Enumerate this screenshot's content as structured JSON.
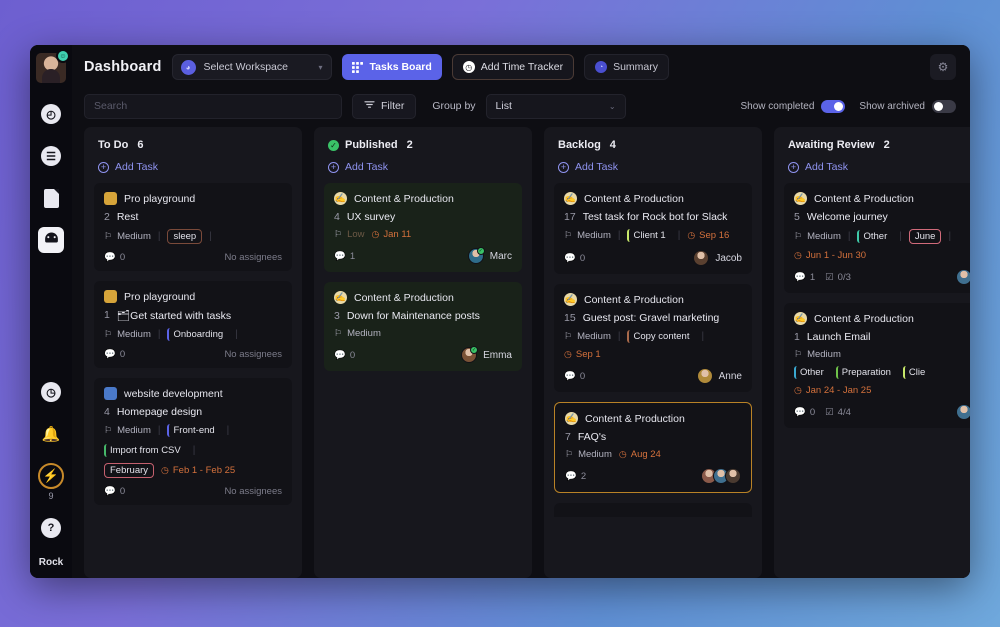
{
  "window": {
    "sidebar": {
      "avatar_name": "user-avatar",
      "items": [
        {
          "name": "timer-icon",
          "glyph": "◴"
        },
        {
          "name": "list-icon",
          "glyph": "☰"
        },
        {
          "name": "document-icon",
          "glyph": ""
        },
        {
          "name": "dashboard-icon",
          "glyph": "◍"
        }
      ],
      "bottom": [
        {
          "name": "history-icon",
          "glyph": "◷"
        },
        {
          "name": "bell-icon",
          "glyph": "🔔"
        }
      ],
      "lightning_glyph": "⚡",
      "lightning_count": "9",
      "help_glyph": "?",
      "user_name": "Rock"
    },
    "topbar": {
      "title": "Dashboard",
      "workspace_label": "Select Workspace",
      "workspace_caret": "▾",
      "tasks_board_label": "Tasks Board",
      "add_time_tracker_label": "Add Time Tracker",
      "summary_label": "Summary",
      "gear_glyph": "⚙"
    },
    "filterbar": {
      "search_placeholder": "Search",
      "search_value": "",
      "filter_label": "Filter",
      "group_by_label": "Group by",
      "group_by_value": "List",
      "group_by_caret": "⌄",
      "show_completed_label": "Show completed",
      "show_completed_on": true,
      "show_archived_label": "Show archived",
      "show_archived_on": false
    },
    "columns": [
      {
        "name": "todo",
        "title": "To Do",
        "count": "6",
        "bullet_color": "",
        "add_task_label": "Add Task",
        "cards": [
          {
            "project": "Pro playground",
            "project_color": "#d6a43a",
            "number": "2",
            "title": "Rest",
            "priority": "Medium",
            "tags": [
              {
                "label": "sleep",
                "color": "#7a4a3a",
                "boxed": true
              }
            ],
            "date": "",
            "comments": "0",
            "checklist": "",
            "assignees_text": "No assignees",
            "avatars": []
          },
          {
            "project": "Pro playground",
            "project_color": "#d6a43a",
            "number": "1",
            "title": "🗂Get started with tasks",
            "priority": "Medium",
            "tags": [
              {
                "label": "Onboarding",
                "color": "#5b63e8",
                "boxed": false
              }
            ],
            "date": "",
            "comments": "0",
            "checklist": "",
            "assignees_text": "No assignees",
            "avatars": []
          },
          {
            "project": "website development",
            "project_color": "#4a79c9",
            "number": "4",
            "title": "Homepage design",
            "priority": "Medium",
            "tags": [
              {
                "label": "Front-end",
                "color": "#5b63e8",
                "boxed": false
              },
              {
                "label": "Import from CSV",
                "color": "#46b86a",
                "boxed": false
              }
            ],
            "month_tag": "February",
            "date": "Feb 1 - Feb 25",
            "comments": "0",
            "checklist": "",
            "assignees_text": "No assignees",
            "avatars": []
          }
        ]
      },
      {
        "name": "published",
        "title": "Published",
        "count": "2",
        "bullet_color": "#3ac267",
        "bullet_glyph": "✓",
        "add_task_label": "Add Task",
        "cards": [
          {
            "style": "green",
            "project": "Content & Production",
            "project_color": "#e8d9a8",
            "number": "4",
            "title": "UX survey",
            "priority": "Low",
            "priority_muted": true,
            "tags": [],
            "date": "Jan 11",
            "comments": "1",
            "checklist": "",
            "assignees_text": "Marc",
            "avatars": [
              {
                "color": "#2e6c8a",
                "online": true
              }
            ]
          },
          {
            "style": "green",
            "project": "Content & Production",
            "project_color": "#e8d9a8",
            "number": "3",
            "title": "Down for Maintenance posts",
            "priority": "Medium",
            "tags": [],
            "date": "",
            "comments": "0",
            "checklist": "",
            "assignees_text": "Emma",
            "avatars": [
              {
                "color": "#7a5236",
                "online": true
              }
            ]
          }
        ]
      },
      {
        "name": "backlog",
        "title": "Backlog",
        "count": "4",
        "bullet_color": "",
        "add_task_label": "Add Task",
        "cards": [
          {
            "project": "Content & Production",
            "project_color": "#e8d9a8",
            "number": "17",
            "title": "Test task for Rock bot for Slack",
            "priority": "Medium",
            "tags": [
              {
                "label": "Client 1",
                "color": "#c7e86a",
                "boxed": false
              }
            ],
            "date": "Sep 16",
            "comments": "0",
            "checklist": "",
            "assignees_text": "Jacob",
            "avatars": [
              {
                "color": "#5a4030",
                "online": false
              }
            ]
          },
          {
            "project": "Content & Production",
            "project_color": "#e8d9a8",
            "number": "15",
            "title": "Guest post: Gravel marketing",
            "priority": "Medium",
            "tags": [
              {
                "label": "Copy content",
                "color": "#a8694a",
                "boxed": false
              }
            ],
            "date": "Sep 1",
            "date_own_row": true,
            "comments": "0",
            "checklist": "",
            "assignees_text": "Anne",
            "avatars": [
              {
                "color": "#b08a3a",
                "online": false
              }
            ]
          },
          {
            "style": "ring",
            "project": "Content & Production",
            "project_color": "#e8d9a8",
            "number": "7",
            "title": "FAQ's",
            "priority": "Medium",
            "tags": [],
            "date": "Aug 24",
            "comments": "2",
            "checklist": "",
            "assignees_text": "",
            "avatars": [
              {
                "color": "#8a5a4a",
                "online": false
              },
              {
                "color": "#3f6f8f",
                "online": false
              },
              {
                "color": "#4a3a30",
                "online": false
              }
            ]
          }
        ]
      },
      {
        "name": "awaiting-review",
        "title": "Awaiting Review",
        "count": "2",
        "bullet_color": "",
        "add_task_label": "Add Task",
        "cards": [
          {
            "project": "Content & Production",
            "project_color": "#e8d9a8",
            "number": "5",
            "title": "Welcome journey",
            "priority": "Medium",
            "tags": [
              {
                "label": "Other",
                "color": "#3fc9a8",
                "boxed": false
              },
              {
                "label": "June",
                "color": "#d06a7a",
                "boxed": true
              }
            ],
            "date": "Jun 1 - Jun 30",
            "date_own_row": true,
            "comments": "1",
            "checklist": "0/3",
            "assignees_text": "",
            "avatars": [
              {
                "color": "#3f6f8f",
                "online": false
              }
            ]
          },
          {
            "project": "Content & Production",
            "project_color": "#e8d9a8",
            "number": "1",
            "title": "Launch Email",
            "priority": "Medium",
            "priority_own_row": true,
            "tags": [
              {
                "label": "Other",
                "color": "#3aa8d0",
                "boxed": false
              },
              {
                "label": "Preparation",
                "color": "#6fc24a",
                "boxed": false
              },
              {
                "label": "Clie",
                "color": "#c7e86a",
                "boxed": false
              }
            ],
            "date": "Jan 24 - Jan 25",
            "date_own_row": true,
            "comments": "0",
            "checklist": "4/4",
            "assignees_text": "",
            "avatars": [
              {
                "color": "#3f6f8f",
                "online": false
              }
            ]
          }
        ]
      }
    ]
  }
}
